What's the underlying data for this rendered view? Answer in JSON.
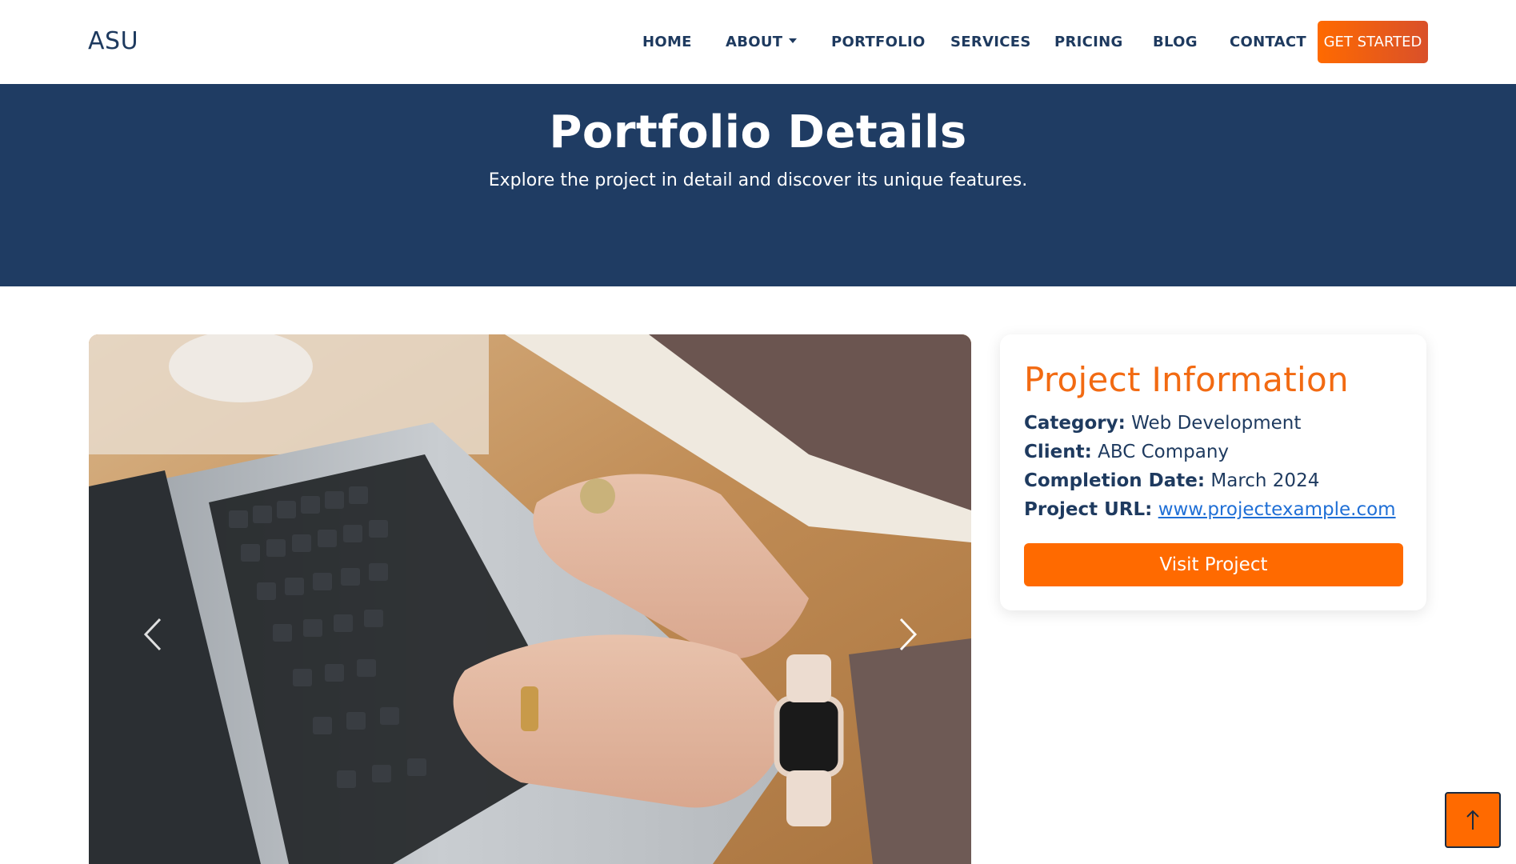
{
  "header": {
    "logo": "ASU",
    "nav": [
      {
        "label": "HOME"
      },
      {
        "label": "ABOUT"
      },
      {
        "label": "PORTFOLIO"
      },
      {
        "label": "SERVICES"
      },
      {
        "label": "PRICING"
      },
      {
        "label": "BLOG"
      },
      {
        "label": "CONTACT"
      }
    ],
    "cta": "GET STARTED"
  },
  "hero": {
    "title": "Portfolio Details",
    "subtitle": "Explore the project in detail and discover its unique features."
  },
  "carousel": {
    "image": "photo of hands typing on a laptop keyboard on a wooden desk",
    "prev_icon": "chevron-left-icon",
    "next_icon": "chevron-right-icon"
  },
  "project_info": {
    "title": "Project Information",
    "category_label": "Category:",
    "category_value": "Web Development",
    "client_label": "Client:",
    "client_value": "ABC Company",
    "date_label": "Completion Date:",
    "date_value": "March 2024",
    "url_label": "Project URL:",
    "url_value": "www.projectexample.com",
    "button": "Visit Project"
  },
  "colors": {
    "navy": "#1f3c63",
    "accent": "#ff6a00",
    "link": "#1f6fd6"
  },
  "scroll_top_icon": "arrow-up-icon"
}
